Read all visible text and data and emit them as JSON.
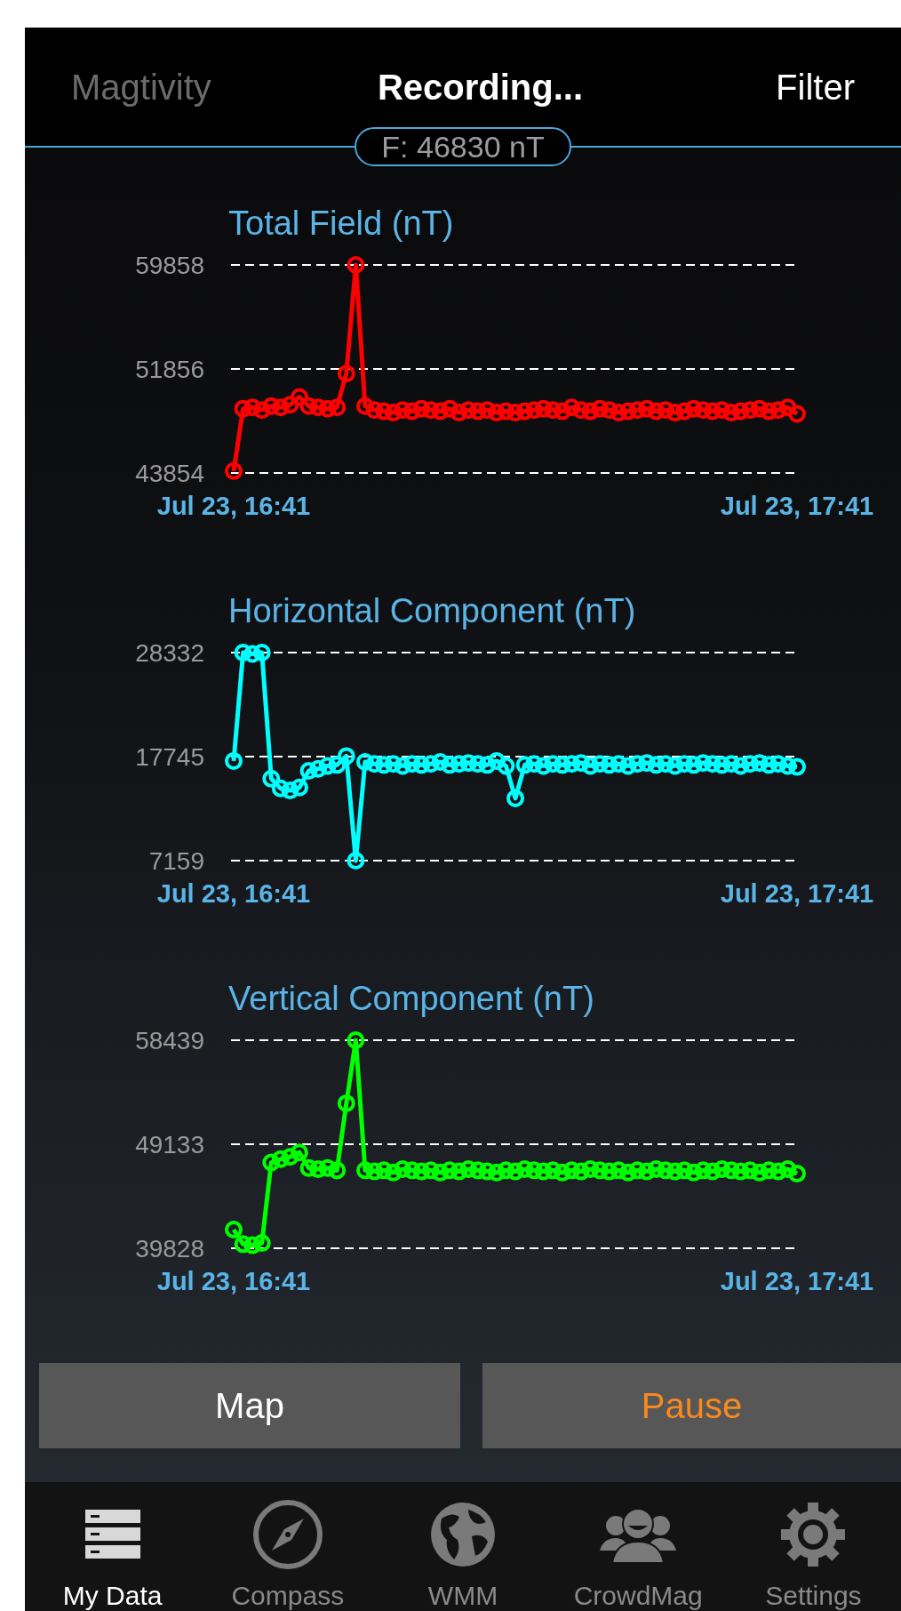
{
  "nav_bar": {
    "back": "Magtivity",
    "title": "Recording...",
    "action": "Filter"
  },
  "reading": "F: 46830 nT",
  "charts": [
    {
      "chart_data": {
        "type": "line",
        "title": "Total Field (nT)",
        "categories": [
          "Jul 23, 16:41",
          null,
          null,
          null,
          null,
          null,
          null,
          null,
          null,
          null,
          null,
          null,
          null,
          null,
          null,
          null,
          null,
          null,
          null,
          null,
          null,
          null,
          null,
          null,
          null,
          null,
          null,
          null,
          null,
          null,
          null,
          null,
          null,
          null,
          null,
          null,
          null,
          null,
          null,
          null,
          null,
          null,
          null,
          null,
          null,
          null,
          null,
          null,
          null,
          null,
          null,
          null,
          null,
          null,
          null,
          null,
          null,
          null,
          null,
          null,
          "Jul 23, 17:41"
        ],
        "series": [
          {
            "color": "#ff0000",
            "marker": "o",
            "values": [
              44000,
              48800,
              48900,
              48700,
              49000,
              48900,
              49100,
              49700,
              49000,
              48900,
              48800,
              48900,
              51500,
              59858,
              49000,
              48700,
              48600,
              48500,
              48700,
              48600,
              48800,
              48700,
              48600,
              48800,
              48500,
              48700,
              48600,
              48700,
              48500,
              48600,
              48500,
              48600,
              48700,
              48800,
              48700,
              48600,
              48900,
              48700,
              48600,
              48800,
              48700,
              48500,
              48600,
              48700,
              48800,
              48600,
              48700,
              48500,
              48600,
              48800,
              48700,
              48600,
              48700,
              48500,
              48600,
              48700,
              48800,
              48600,
              48700,
              48900,
              48400
            ]
          }
        ],
        "ylim": [
          43854,
          59858
        ],
        "yticks": [
          43854,
          51856,
          59858
        ]
      }
    },
    {
      "chart_data": {
        "type": "line",
        "title": "Horizontal Component (nT)",
        "categories": [
          "Jul 23, 16:41",
          null,
          null,
          null,
          null,
          null,
          null,
          null,
          null,
          null,
          null,
          null,
          null,
          null,
          null,
          null,
          null,
          null,
          null,
          null,
          null,
          null,
          null,
          null,
          null,
          null,
          null,
          null,
          null,
          null,
          null,
          null,
          null,
          null,
          null,
          null,
          null,
          null,
          null,
          null,
          null,
          null,
          null,
          null,
          null,
          null,
          null,
          null,
          null,
          null,
          null,
          null,
          null,
          null,
          null,
          null,
          null,
          null,
          null,
          null,
          "Jul 23, 17:41"
        ],
        "series": [
          {
            "color": "#00ffff",
            "marker": "o",
            "values": [
              17300,
              28332,
              28200,
              28332,
              15500,
              14500,
              14300,
              14600,
              16300,
              16500,
              16800,
              16900,
              17800,
              7159,
              17200,
              17000,
              16900,
              17000,
              16800,
              17000,
              16900,
              17000,
              17200,
              16900,
              17000,
              17100,
              17000,
              16900,
              17300,
              16800,
              13500,
              16900,
              17000,
              16800,
              17000,
              16900,
              17000,
              17100,
              16800,
              17000,
              16900,
              17000,
              16800,
              17000,
              17100,
              16900,
              17000,
              16800,
              17000,
              16900,
              17100,
              17000,
              16900,
              17000,
              16800,
              17000,
              17100,
              16900,
              17000,
              16800,
              16700
            ]
          }
        ],
        "ylim": [
          7159,
          28332
        ],
        "yticks": [
          7159,
          17745,
          28332
        ]
      }
    },
    {
      "chart_data": {
        "type": "line",
        "title": "Vertical Component (nT)",
        "categories": [
          "Jul 23, 16:41",
          null,
          null,
          null,
          null,
          null,
          null,
          null,
          null,
          null,
          null,
          null,
          null,
          null,
          null,
          null,
          null,
          null,
          null,
          null,
          null,
          null,
          null,
          null,
          null,
          null,
          null,
          null,
          null,
          null,
          null,
          null,
          null,
          null,
          null,
          null,
          null,
          null,
          null,
          null,
          null,
          null,
          null,
          null,
          null,
          null,
          null,
          null,
          null,
          null,
          null,
          null,
          null,
          null,
          null,
          null,
          null,
          null,
          null,
          null,
          "Jul 23, 17:41"
        ],
        "series": [
          {
            "color": "#00ff00",
            "marker": "o",
            "values": [
              41500,
              40200,
              40100,
              40300,
              47500,
              47800,
              48000,
              48400,
              47000,
              46900,
              47000,
              46800,
              52800,
              58439,
              46800,
              46700,
              46800,
              46600,
              46900,
              46800,
              46700,
              46800,
              46600,
              46800,
              46700,
              46900,
              46800,
              46700,
              46600,
              46800,
              46700,
              46900,
              46800,
              46700,
              46800,
              46600,
              46800,
              46700,
              46900,
              46800,
              46700,
              46800,
              46600,
              46800,
              46700,
              46900,
              46800,
              46700,
              46800,
              46600,
              46800,
              46700,
              46900,
              46800,
              46700,
              46800,
              46600,
              46800,
              46700,
              46900,
              46500
            ]
          }
        ],
        "ylim": [
          39828,
          58439
        ],
        "yticks": [
          39828,
          49133,
          58439
        ]
      }
    }
  ],
  "buttons": [
    {
      "label": "Map",
      "kind": "normal"
    },
    {
      "label": "Pause",
      "kind": "accent"
    }
  ],
  "tab_bar": [
    {
      "label": "My Data",
      "selected": true
    },
    {
      "label": "Compass",
      "selected": false
    },
    {
      "label": "WMM",
      "selected": false
    },
    {
      "label": "CrowdMag",
      "selected": false
    },
    {
      "label": "Settings",
      "selected": false
    }
  ]
}
